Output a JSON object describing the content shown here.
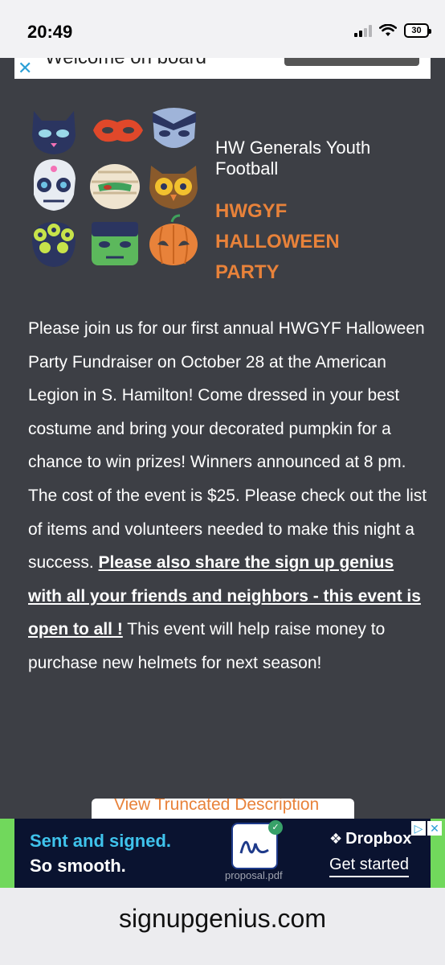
{
  "status_bar": {
    "time": "20:49",
    "battery": "30"
  },
  "top_ad": {
    "text": "Welcome on board"
  },
  "masks": [
    "cat-mask-icon",
    "red-mask-icon",
    "vampire-mask-icon",
    "skull-mask-icon",
    "mummy-mask-icon",
    "owl-mask-icon",
    "monster-mask-icon",
    "frankenstein-mask-icon",
    "pumpkin-mask-icon"
  ],
  "organization": "HW Generals Youth Football",
  "event_title": "HWGYF HALLOWEEN PARTY",
  "description": {
    "part1": "Please join us for our first annual HWGYF Halloween Party Fundraiser on October 28 at the American Legion in S. Hamilton! Come dressed in your best costume and bring your decorated pumpkin for a chance to win prizes!  Winners announced at 8 pm.  The cost of the event is $25.  Please check out the list of items and volunteers needed to make this night a success. ",
    "link": "Please also share the sign up genius with all your friends and neighbors -  this event is open to all !",
    "part2": " This event will help raise money to purchase new helmets for next season!"
  },
  "view_button": "View Truncated Description",
  "ad": {
    "line1": "Sent and signed.",
    "line2": "So smooth.",
    "file": "proposal.pdf",
    "brand": "Dropbox",
    "cta": "Get started"
  },
  "url": "signupgenius.com",
  "colors": {
    "background": "#3d3f45",
    "accent": "#e8823a",
    "ad_green": "#71d85c",
    "ad_navy": "#0a1330"
  }
}
